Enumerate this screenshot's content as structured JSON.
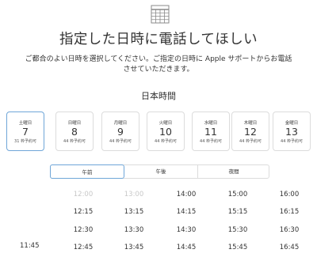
{
  "header": {
    "icon": "calendar-icon",
    "title": "指定した日時に電話してほしい",
    "description": "ご都合のよい日時を選択してください。ご指定の日時に Apple サポートからお電話させていただきます。"
  },
  "timezone_label": "日本時間",
  "dates": [
    {
      "dow": "土曜日",
      "day": "7",
      "count": "31 枠予約可",
      "selected": true
    },
    {
      "dow": "日曜日",
      "day": "8",
      "count": "44 枠予約可",
      "selected": false
    },
    {
      "dow": "月曜日",
      "day": "9",
      "count": "44 枠予約可",
      "selected": false
    },
    {
      "dow": "火曜日",
      "day": "10",
      "count": "44 枠予約可",
      "selected": false
    },
    {
      "dow": "水曜日",
      "day": "11",
      "count": "44 枠予約可",
      "selected": false
    },
    {
      "dow": "木曜日",
      "day": "12",
      "count": "44 枠予約可",
      "selected": false
    },
    {
      "dow": "金曜日",
      "day": "13",
      "count": "44 枠予約可",
      "selected": false
    }
  ],
  "periods": [
    {
      "label": "午前",
      "active": true
    },
    {
      "label": "午後",
      "active": false
    },
    {
      "label": "夜間",
      "active": false
    }
  ],
  "time_columns": [
    [
      {
        "t": "12:00",
        "disabled": true
      },
      {
        "t": "12:15"
      },
      {
        "t": "12:30"
      },
      {
        "t": "12:45"
      }
    ],
    [
      {
        "t": "13:00",
        "disabled": true
      },
      {
        "t": "13:15"
      },
      {
        "t": "13:30"
      },
      {
        "t": "13:45"
      }
    ],
    [
      {
        "t": "14:00"
      },
      {
        "t": "14:15"
      },
      {
        "t": "14:30"
      },
      {
        "t": "14:45"
      }
    ],
    [
      {
        "t": "15:00"
      },
      {
        "t": "15:15"
      },
      {
        "t": "15:30"
      },
      {
        "t": "15:45"
      }
    ],
    [
      {
        "t": "16:00"
      },
      {
        "t": "16:15"
      },
      {
        "t": "16:30"
      },
      {
        "t": "16:45"
      }
    ]
  ],
  "extra_time": "11:45",
  "colors": {
    "accent_border": "#6fa6d8",
    "disabled_text": "#c8c8c8"
  }
}
